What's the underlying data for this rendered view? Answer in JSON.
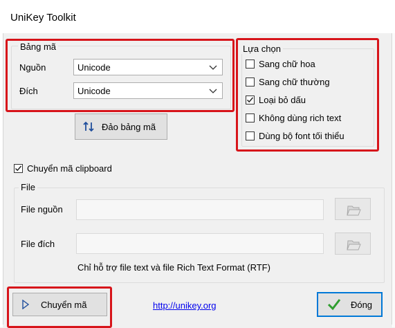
{
  "window": {
    "title": "UniKey Toolkit"
  },
  "bang_ma": {
    "group_label": "Bảng mã",
    "source_label": "Nguồn",
    "source_value": "Unicode",
    "dest_label": "Đích",
    "dest_value": "Unicode",
    "swap_button": "Đảo bảng mã"
  },
  "options": {
    "group_label": "Lựa chọn",
    "items": [
      {
        "label": "Sang chữ hoa",
        "checked": false
      },
      {
        "label": "Sang chữ thường",
        "checked": false
      },
      {
        "label": "Loại bỏ dấu",
        "checked": true
      },
      {
        "label": "Không dùng rich text",
        "checked": false
      },
      {
        "label": "Dùng bộ font tối thiểu",
        "checked": false
      }
    ]
  },
  "clipboard": {
    "label": "Chuyển mã clipboard",
    "checked": true
  },
  "file": {
    "group_label": "File",
    "source_label": "File nguồn",
    "source_value": "",
    "dest_label": "File đích",
    "dest_value": "",
    "note": "Chỉ hỗ trợ file text và file Rich Text Format (RTF)"
  },
  "footer": {
    "convert_button": "Chuyển mã",
    "link": "http://unikey.org",
    "close_button": "Đóng"
  },
  "colors": {
    "highlight": "#d7141a",
    "accent": "#0078d7",
    "check_green": "#2f9d2f"
  }
}
